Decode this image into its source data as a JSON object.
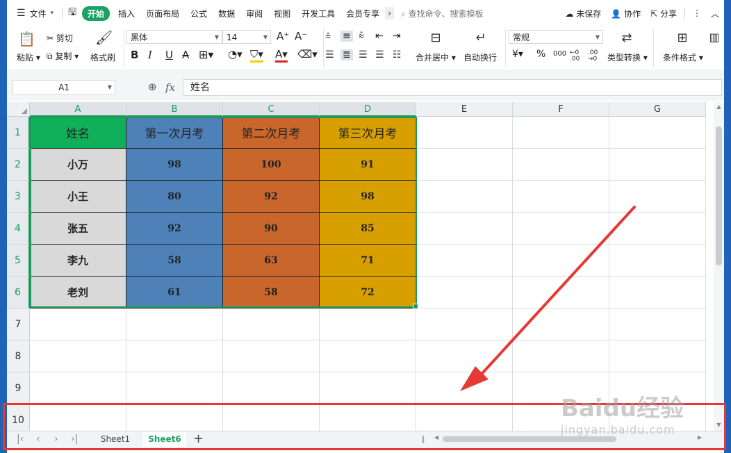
{
  "menubar": {
    "file": "文件",
    "tabs": [
      "开始",
      "插入",
      "页面布局",
      "公式",
      "数据",
      "审阅",
      "视图",
      "开发工具",
      "会员专享"
    ],
    "search_placeholder": "查找命令、搜索模板",
    "unsaved": "未保存",
    "collab": "协作",
    "share": "分享"
  },
  "ribbon": {
    "paste": "粘贴",
    "cut": "剪切",
    "copy": "复制",
    "format_painter": "格式刷",
    "font_name": "黑体",
    "font_size": "14",
    "merge_center": "合并居中",
    "wrap_text": "自动换行",
    "number_format": "常规",
    "type_convert": "类型转换",
    "cond_format": "条件格式",
    "bold": "B",
    "italic": "I",
    "underline": "U",
    "strike": "A",
    "percent": "%",
    "thousands": "000",
    "currency": "¥",
    "dec_inc": "←0 .00",
    "dec_dec": ".00 →0"
  },
  "formula_bar": {
    "cell_ref": "A1",
    "fx": "fx",
    "content": "姓名"
  },
  "grid": {
    "columns": [
      "A",
      "B",
      "C",
      "D",
      "E",
      "F",
      "G"
    ],
    "rows": [
      "1",
      "2",
      "3",
      "4",
      "5",
      "6",
      "7",
      "8",
      "9",
      "10"
    ]
  },
  "table": {
    "headers": [
      "姓名",
      "第一次月考",
      "第二次月考",
      "第三次月考"
    ],
    "rows": [
      [
        "小万",
        "98",
        "100",
        "91"
      ],
      [
        "小王",
        "80",
        "92",
        "98"
      ],
      [
        "张五",
        "92",
        "90",
        "85"
      ],
      [
        "李九",
        "58",
        "63",
        "71"
      ],
      [
        "老刘",
        "61",
        "58",
        "72"
      ]
    ]
  },
  "colors": {
    "name_header": "#10b05a",
    "col_b": "#4e81b7",
    "col_c": "#c8662b",
    "col_d": "#d7a000",
    "name_cells": "#d9d9d9",
    "accent": "#1aa262",
    "annotation": "#e53935"
  },
  "sheets": {
    "tabs": [
      "Sheet1",
      "Sheet6"
    ],
    "active": "Sheet6",
    "add": "+"
  },
  "watermark": {
    "brand": "Baidu经验",
    "url": "jingyan.baidu.com"
  }
}
